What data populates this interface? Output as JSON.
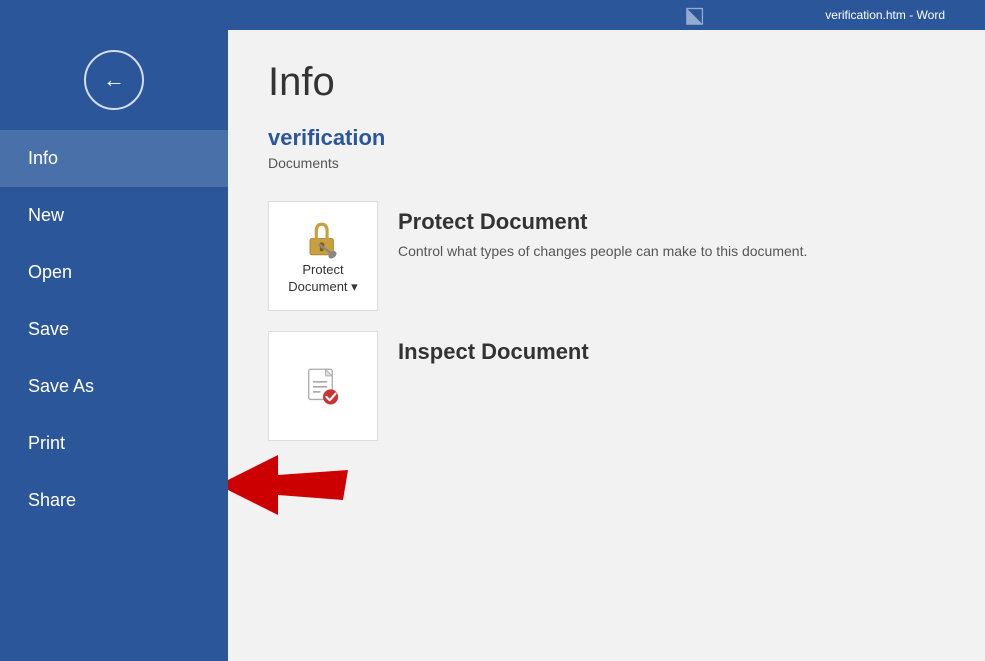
{
  "topbar": {
    "title": "verification.htm - Word"
  },
  "sidebar": {
    "back_button_label": "←",
    "items": [
      {
        "id": "info",
        "label": "Info",
        "active": true
      },
      {
        "id": "new",
        "label": "New",
        "active": false
      },
      {
        "id": "open",
        "label": "Open",
        "active": false
      },
      {
        "id": "save",
        "label": "Save",
        "active": false
      },
      {
        "id": "save-as",
        "label": "Save As",
        "active": false
      },
      {
        "id": "print",
        "label": "Print",
        "active": false
      },
      {
        "id": "share",
        "label": "Share",
        "active": false
      }
    ]
  },
  "content": {
    "page_title": "Info",
    "doc_name": "verification",
    "doc_path": "Documents",
    "cards": [
      {
        "id": "protect",
        "icon_label": "Protect\nDocument ▾",
        "title": "Protect Document",
        "description": "Control what types of changes people can make to this document."
      },
      {
        "id": "inspect",
        "icon_label": "",
        "title": "Inspect Document",
        "description": ""
      }
    ]
  }
}
